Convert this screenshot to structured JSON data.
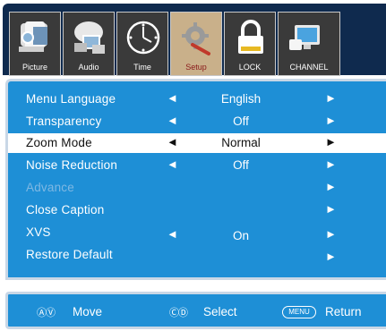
{
  "tabs": [
    {
      "label": "Picture",
      "icon": "picture-icon",
      "active": false
    },
    {
      "label": "Audio",
      "icon": "audio-icon",
      "active": false
    },
    {
      "label": "Time",
      "icon": "clock-icon",
      "active": false
    },
    {
      "label": "Setup",
      "icon": "setup-wrench-icon",
      "active": true
    },
    {
      "label": "LOCK",
      "icon": "lock-icon",
      "active": false
    },
    {
      "label": "CHANNEL",
      "icon": "channel-monitor-icon",
      "active": false
    }
  ],
  "menu": {
    "rows": [
      {
        "label": "Menu Language",
        "value": "English",
        "left_arrow": "◄",
        "right_arrow": "►"
      },
      {
        "label": "Transparency",
        "value": "Off",
        "left_arrow": "◄",
        "right_arrow": "►"
      },
      {
        "label": "Zoom Mode",
        "value": "Normal",
        "left_arrow": "◄",
        "right_arrow": "►"
      },
      {
        "label": "Noise Reduction",
        "value": "Off",
        "left_arrow": "◄",
        "right_arrow": "►"
      },
      {
        "label": "Advance",
        "value": "",
        "left_arrow": "",
        "right_arrow": "►"
      },
      {
        "label": "Close Caption",
        "value": "",
        "left_arrow": "",
        "right_arrow": "►"
      },
      {
        "label": "XVS",
        "value": "On",
        "left_arrow": "◄",
        "right_arrow": "►"
      },
      {
        "label": "Restore Default",
        "value": "",
        "left_arrow": "",
        "right_arrow": "►"
      }
    ],
    "selected_index": 2,
    "disabled_index": 4
  },
  "footer": {
    "move_keys": "ⒶⓋ",
    "move_label": "Move",
    "select_keys": "ⒸⒹ",
    "select_label": "Select",
    "menu_key": "MENU",
    "return_label": "Return"
  },
  "colors": {
    "panel": "#1e8fd6",
    "tabbar": "#0f2a4e",
    "active_tab": "#c9b08a",
    "selected_row": "#ffffff"
  }
}
